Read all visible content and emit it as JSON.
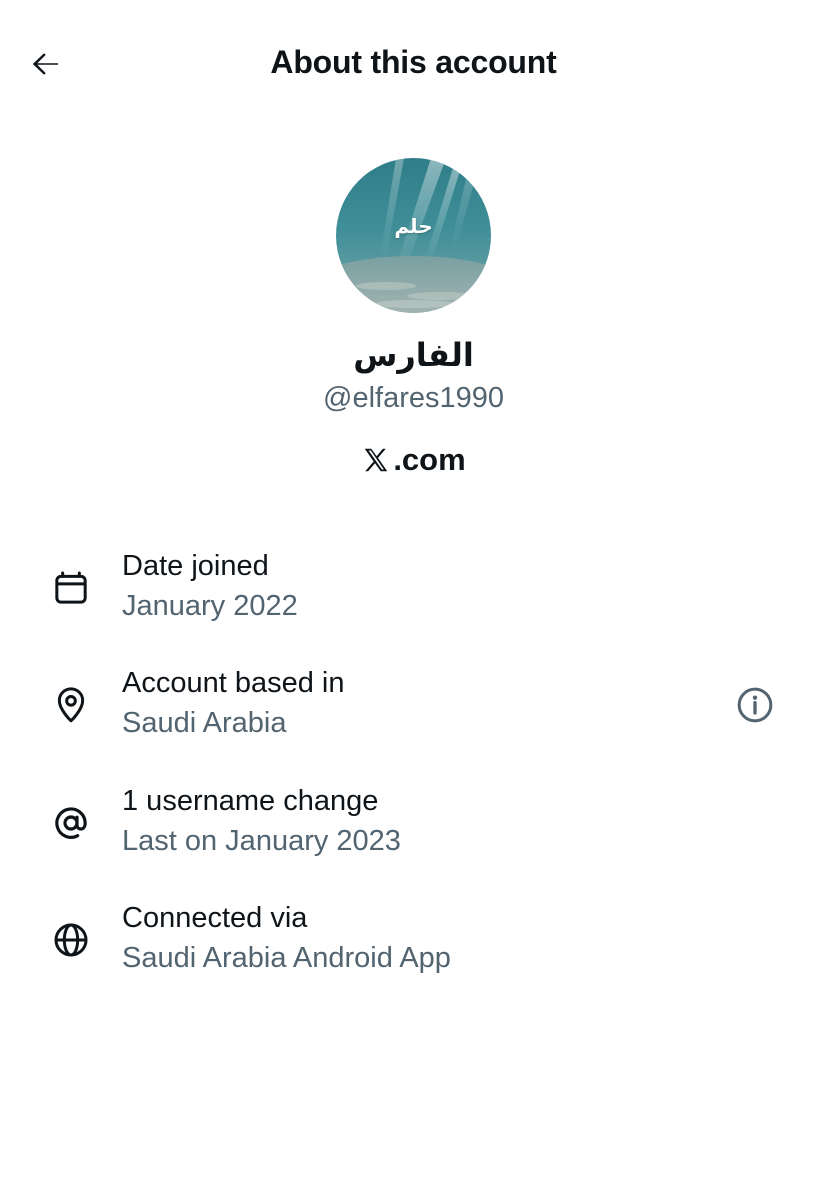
{
  "header": {
    "title": "About this account",
    "back_icon": "arrow-left-icon"
  },
  "profile": {
    "avatar_text": "حلم",
    "display_name": "الفارس",
    "handle": "@elfares1990",
    "platform_text": ".com",
    "platform_icon": "x-logo-icon"
  },
  "details": [
    {
      "icon": "calendar-icon",
      "label": "Date joined",
      "value": "January 2022"
    },
    {
      "icon": "location-pin-icon",
      "label": "Account based in",
      "value": "Saudi Arabia",
      "action_icon": "info-icon"
    },
    {
      "icon": "at-sign-icon",
      "label": "1 username change",
      "value": "Last on January 2023"
    },
    {
      "icon": "globe-icon",
      "label": "Connected via",
      "value": "Saudi Arabia Android App"
    }
  ],
  "colors": {
    "text_primary": "#0f1419",
    "text_secondary": "#536471",
    "background": "#ffffff"
  }
}
